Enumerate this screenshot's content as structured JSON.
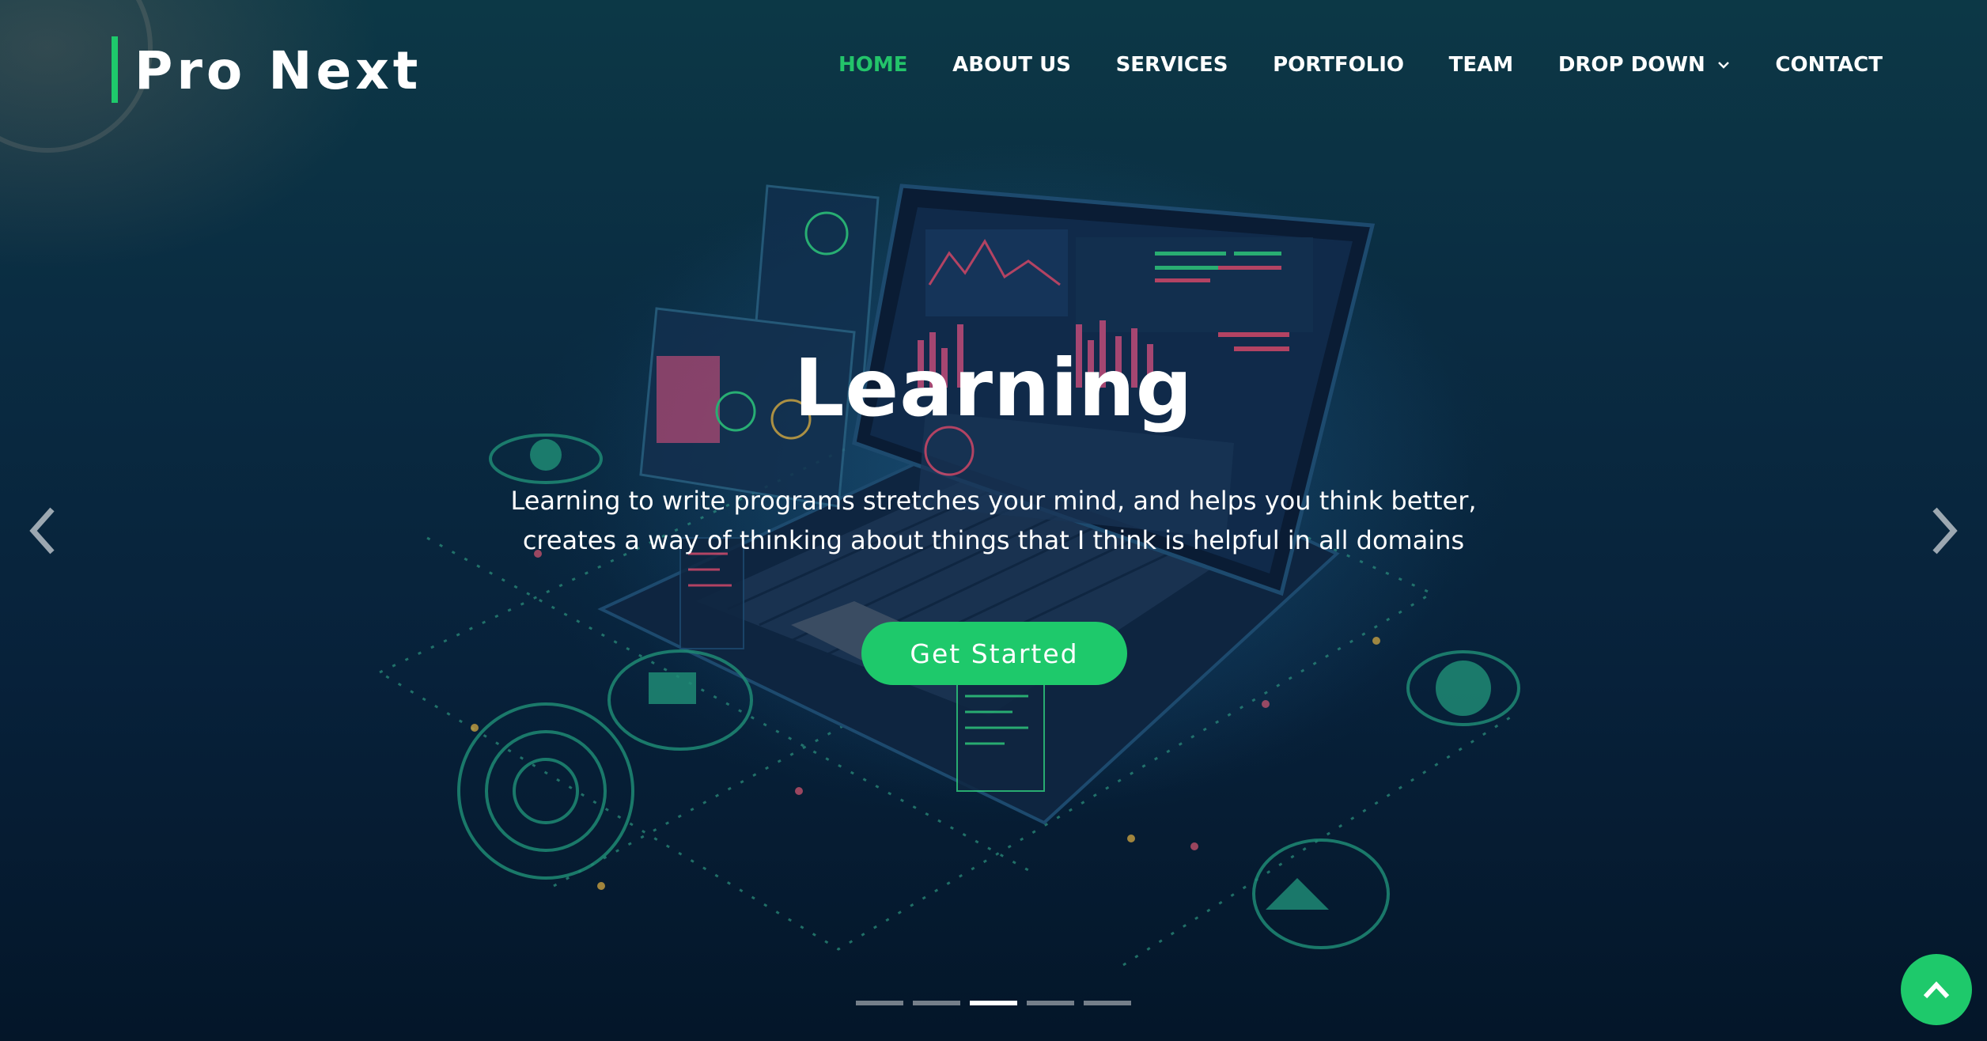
{
  "brand": {
    "name": "Pro Next",
    "accent_color": "#1ec96b"
  },
  "nav": {
    "items": [
      {
        "label": "HOME",
        "active": true
      },
      {
        "label": "ABOUT US"
      },
      {
        "label": "SERVICES"
      },
      {
        "label": "PORTFOLIO"
      },
      {
        "label": "TEAM"
      },
      {
        "label": "DROP DOWN",
        "has_dropdown": true,
        "icon": "chevron-down-icon"
      },
      {
        "label": "CONTACT"
      }
    ]
  },
  "hero": {
    "title": "Learning",
    "description": "Learning to write programs stretches your mind, and helps you think better, creates a way of thinking about things that I think is helpful in all domains",
    "cta_label": "Get Started",
    "background_image": "laptop-with-data-dashboards-illustration"
  },
  "carousel": {
    "prev_icon": "chevron-left-icon",
    "next_icon": "chevron-right-icon",
    "indicator_count": 5,
    "active_index": 2
  },
  "back_to_top": {
    "icon": "chevron-up-icon"
  }
}
